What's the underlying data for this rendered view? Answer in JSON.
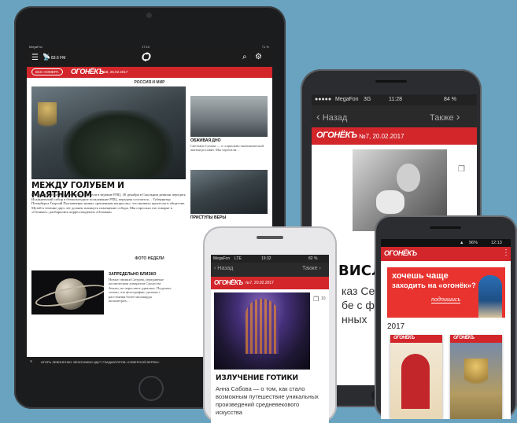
{
  "ipad": {
    "status": {
      "carrier": "MegaFon",
      "time": "17:10",
      "battery": "71 %"
    },
    "toolbar": {
      "subtitle": "83.6 FM"
    },
    "issues_button": "ВСЕ НОМЕРА",
    "logo": "ОГОНЁКЪ",
    "issue": "№8, 26.02.2017",
    "section": "РОССИЯ И МИР",
    "main_headline": "МЕЖДУ ГОЛУБЕМ И МАЯТНИКОМ",
    "main_body": "Исаакиевский собор не вернули до недели в ведение РПЦ. 30 декабря в Смольном решили передать Исаакиевский собор в безвозмездное пользование РПЦ, передача состоится… Губернатор Петербурга Георгий Полтавченко назвал «решенным вопросом», что вызвало протесты в обществе. Музей в течение двух лет должен покинуть помещение собора. Мы спросили что говорят в «Огоньке», разбирались корреспонденты «Огонька»",
    "side1_title": "ОБЖИВАЯ ДНО",
    "side1_text": "Светлана Сухова — о социально-экономической апатии россиян. Мы спросили…",
    "side2_title": "ПРИСТУПЫ ВЕРЫ",
    "side2_text": "",
    "photo_section": "ФОТО НЕДЕЛИ",
    "photo_title": "ЗАПРЕДЕЛЬНО БЛИЗКО",
    "photo_text": "Новые снимки Сатурна, переданные космическим аппаратом Cassini на Землю, не перестают удивлять. Подумать только, что фотографии сделаны с расстояния более миллиарда километров…",
    "ticker": "ИГОРЬ ЛЕВОНЕНКО: ВЕЗОЧНИКИ ИДУТ ГЛАДИАТОРОВ «СЕВЕРНОЙ ВЕРФИ»"
  },
  "galaxy": {
    "status": {
      "carrier": "MegaFon",
      "network": "3G",
      "time": "11:28",
      "battery": "84 %"
    },
    "nav": {
      "back": "Назад",
      "forward": "Также"
    },
    "logo": "ОГОНЁКЪ",
    "issue": "№7, 20.02.2017",
    "headline_fragment": "ВИСЛО",
    "body_fragments": [
      "каз Се",
      "бе с ф",
      "нных"
    ]
  },
  "iphone": {
    "status": {
      "carrier": "MegaFon",
      "network": "LTE",
      "time": "19:32",
      "battery": "82 %"
    },
    "nav": {
      "back": "Назад",
      "forward": "Также"
    },
    "logo": "ОГОНЁКЪ",
    "issue": "№7, 20.02.2017",
    "photo_count": "10",
    "headline": "ИЗЛУЧЕНИЕ ГОТИКИ",
    "body": "Анна Сабова — о том, как стало возможным путешествие уникальных произведений средневекового искусства"
  },
  "android": {
    "status": {
      "time": "12:13",
      "battery": "96%"
    },
    "logo": "ОГОНЁКЪ",
    "promo_line1": "хочешь чаще",
    "promo_line2": "заходить на «огонёк»?",
    "promo_cta": "подпишись",
    "year": "2017",
    "cover_logo": "ОГОНЁКЪ"
  }
}
